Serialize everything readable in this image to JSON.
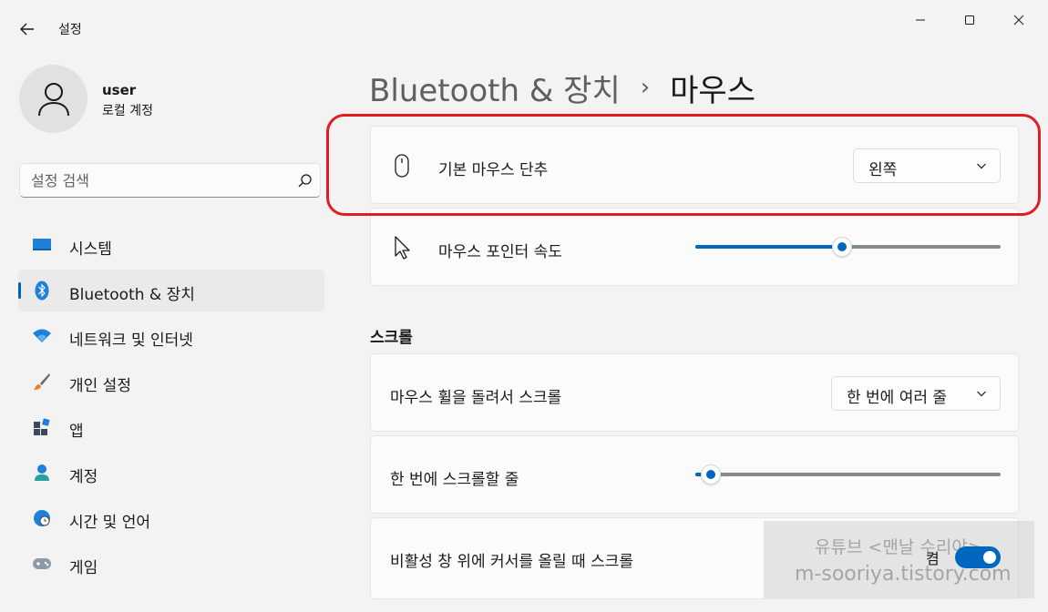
{
  "window": {
    "title": "설정"
  },
  "user": {
    "name": "user",
    "account_type": "로컬 계정"
  },
  "search": {
    "placeholder": "설정 검색"
  },
  "sidebar": {
    "items": [
      {
        "label": "시스템",
        "icon": "system-icon",
        "active": false
      },
      {
        "label": "Bluetooth & 장치",
        "icon": "bluetooth-icon",
        "active": true
      },
      {
        "label": "네트워크 및 인터넷",
        "icon": "network-icon",
        "active": false
      },
      {
        "label": "개인 설정",
        "icon": "personalization-brush-icon",
        "active": false
      },
      {
        "label": "앱",
        "icon": "apps-icon",
        "active": false
      },
      {
        "label": "계정",
        "icon": "account-icon",
        "active": false
      },
      {
        "label": "시간 및 언어",
        "icon": "time-language-icon",
        "active": false
      },
      {
        "label": "게임",
        "icon": "gaming-controller-icon",
        "active": false
      }
    ]
  },
  "breadcrumb": {
    "parent": "Bluetooth & 장치",
    "separator": "›",
    "current": "마우스"
  },
  "settings": {
    "primary_button": {
      "label": "기본 마우스 단추",
      "value": "왼쪽",
      "icon": "mouse-icon"
    },
    "pointer_speed": {
      "label": "마우스 포인터 속도",
      "icon": "pointer-cursor-icon",
      "level": 0.48
    },
    "scroll_section_title": "스크롤",
    "wheel_scroll": {
      "label": "마우스 휠을 돌려서 스크롤",
      "value": "한 번에 여러 줄"
    },
    "lines_to_scroll": {
      "label": "한 번에 스크롤할 줄",
      "level": 0.05
    },
    "inactive_scroll": {
      "label": "비활성 창 위에 커서를 올릴 때 스크롤",
      "state_label": "켬",
      "on": true
    }
  },
  "watermark": {
    "line1": "유튜브 <맨날 수리야>",
    "line2": "m-sooriya.tistory.com"
  },
  "colors": {
    "accent": "#0067c0",
    "highlight_border": "#e01c24",
    "background": "#f3f3f3",
    "card": "#fbfbfb"
  }
}
